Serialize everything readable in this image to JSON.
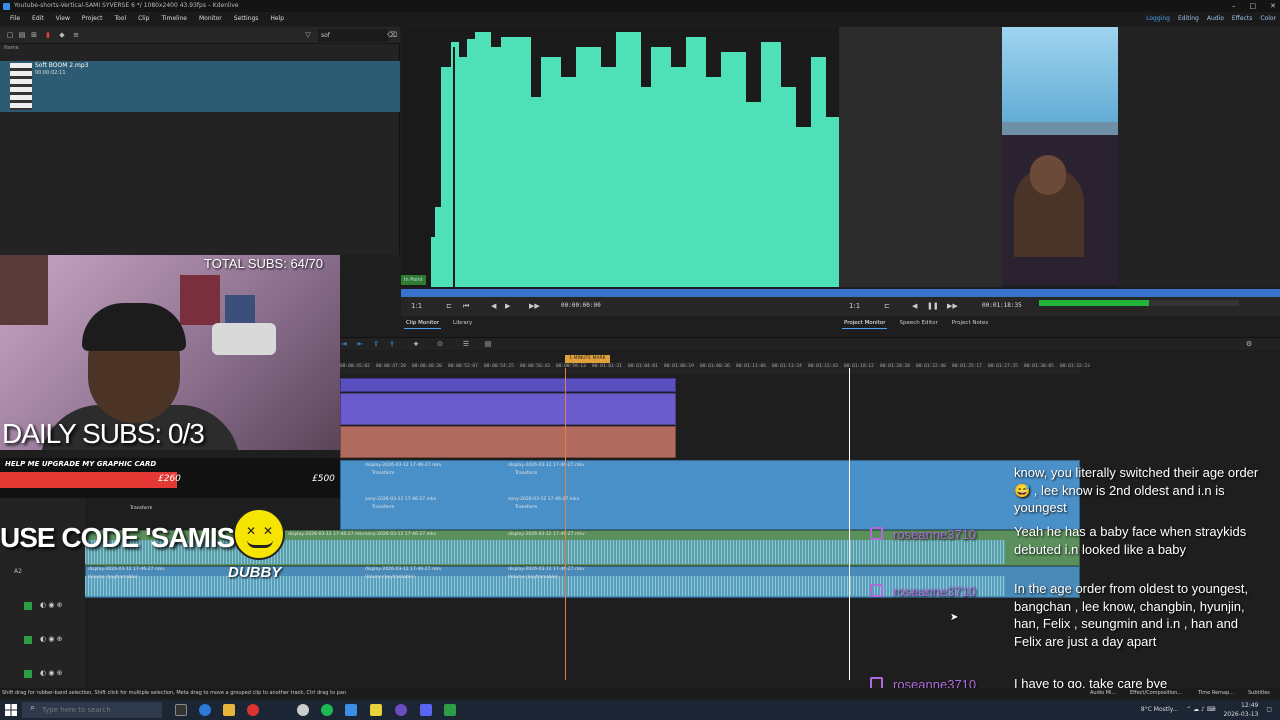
{
  "window": {
    "title": "Youtube-shorts-Vertical-SAMI SYVERSE 6 */ 1080x2400 43.93fps – Kdenlive",
    "controls": [
      "–",
      "□",
      "✕"
    ]
  },
  "menu": [
    "File",
    "Edit",
    "View",
    "Project",
    "Tool",
    "Clip",
    "Timeline",
    "Monitor",
    "Settings",
    "Help"
  ],
  "layouts": [
    "Logging",
    "Editing",
    "Audio",
    "Effects",
    "Color"
  ],
  "bin": {
    "search_value": "sof",
    "column_header": "Name",
    "clip_name": "Soft BOOM 2.mp3",
    "clip_duration": "00:00:02:11"
  },
  "clip_monitor": {
    "in_point_label": "In Point",
    "zoom": "1:1",
    "timecode": "00:00:00:00",
    "tabs": [
      "Clip Monitor",
      "Library"
    ]
  },
  "project_monitor": {
    "zoom": "1:1",
    "timecode": "00:01:18:35",
    "tabs": [
      "Project Monitor",
      "Speech Editor",
      "Project Notes"
    ]
  },
  "audio_meter_level": 0.55,
  "overlay": {
    "total_subs": "TOTAL SUBS: 64/70",
    "daily_subs": "DAILY SUBS: 0/3",
    "goal_title": "HELP ME UPGRADE MY GRAPHIC CARD",
    "goal_current": "£260",
    "goal_max": "£500",
    "goal_progress": 0.52,
    "code_banner": "USE CODE 'SAMISY'",
    "sponsor": "DUBBY"
  },
  "timeline": {
    "marker_label": "1 MINUTE MARK",
    "ruler_ticks": [
      "00:00:45:02",
      "00:00:47:20",
      "00:00:48:38",
      "00:00:52:07",
      "00:00:54:25",
      "00:00:56:43",
      "00:00:59:13",
      "00:01:01:31",
      "00:01:04:01",
      "00:01:06:19",
      "00:01:08:36",
      "00:01:11:06",
      "00:01:13:24",
      "00:01:15:43",
      "00:01:18:12",
      "00:01:20:30",
      "00:01:22:48",
      "00:01:25:17",
      "00:01:27:35",
      "00:01:30:05",
      "00:01:32:23"
    ],
    "clips": [
      {
        "name": "display-2026-03-12 17-46-27.mkv",
        "sub": "Transform"
      },
      {
        "name": "display-2026-03-12 17-46-27.mkv",
        "sub": "Transform"
      },
      {
        "name": "sony-2026-03-12 17-46-27.mkv",
        "sub": "Transform"
      },
      {
        "name": "sony-2026-03-12 17-46-27.mkv",
        "sub": "Transform"
      },
      {
        "name": "Transform",
        "sub": ""
      },
      {
        "name": "display-2026-03-12 17-46-27.mkv",
        "sub": "Volume (keyframable)"
      },
      {
        "name": "sony-2026-03-12 17-46-27.mkv",
        "sub": "Volume (keyframable)"
      },
      {
        "name": "display-2026-03-12 17-46-27.mkv",
        "sub": "Volume (keyframable)"
      },
      {
        "name": "display-2026-03-12 17-46-27.mkv",
        "sub": "Volume (keyframable)"
      },
      {
        "name": "display-2026-03-12 17-46-27.mkv",
        "sub": "Volume (keyframable)"
      }
    ],
    "track_labels": [
      "A2",
      "A3",
      "A4",
      "A5"
    ]
  },
  "chat": [
    {
      "user": "",
      "message": "know, you literally switched their age order 😅 , lee know is 2nd oldest and i.n is youngest"
    },
    {
      "user": "roseanne3710",
      "message": "Yeah he has a baby face when straykids debuted i.n looked like a baby"
    },
    {
      "user": "roseanne3710",
      "message": "In the age order from oldest to youngest, bangchan , lee know, changbin, hyunjin, han, Felix , seungmin and i.n , han and Felix are just a day apart"
    },
    {
      "user": "roseanne3710",
      "message": "I have to go, take care bye"
    }
  ],
  "status": {
    "hint": "Shift drag for rubber-band selection, Shift click for multiple selection, Meta drag to move a grouped clip to another track, Ctrl drag to pan",
    "right_tabs": [
      "Audio Mi...",
      "Effect/Composition...",
      "Time Remap...",
      "Subtitles"
    ]
  },
  "taskbar": {
    "search_placeholder": "Type here to search",
    "weather": "8°C Mostly...",
    "time": "12:49",
    "date": "2026-03-13"
  },
  "colors": {
    "accent": "#4aa3f5",
    "waveform": "#4ee0b6",
    "video_track": "#6a5ccc",
    "audio_track": "#4a90c8",
    "goal_fill": "#e53935",
    "chat_user": "#b06bdb"
  }
}
